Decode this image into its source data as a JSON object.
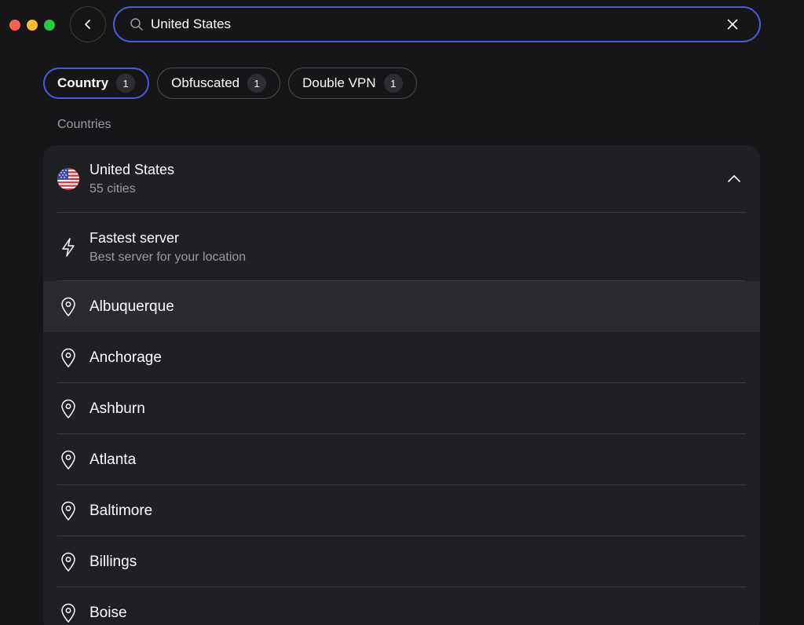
{
  "search": {
    "value": "United States",
    "placeholder": ""
  },
  "filters": [
    {
      "label": "Country",
      "count": "1",
      "active": true
    },
    {
      "label": "Obfuscated",
      "count": "1",
      "active": false
    },
    {
      "label": "Double VPN",
      "count": "1",
      "active": false
    }
  ],
  "section_label": "Countries",
  "country": {
    "name": "United States",
    "sub": "55 cities",
    "flag_icon": "us-flag-icon"
  },
  "fastest": {
    "title": "Fastest server",
    "sub": "Best server for your location"
  },
  "cities": [
    "Albuquerque",
    "Anchorage",
    "Ashburn",
    "Atlanta",
    "Baltimore",
    "Billings",
    "Boise"
  ],
  "colors": {
    "accent": "#4a5bd9",
    "background": "#161618",
    "card": "#1f2023",
    "hover": "#2a2b2f"
  }
}
